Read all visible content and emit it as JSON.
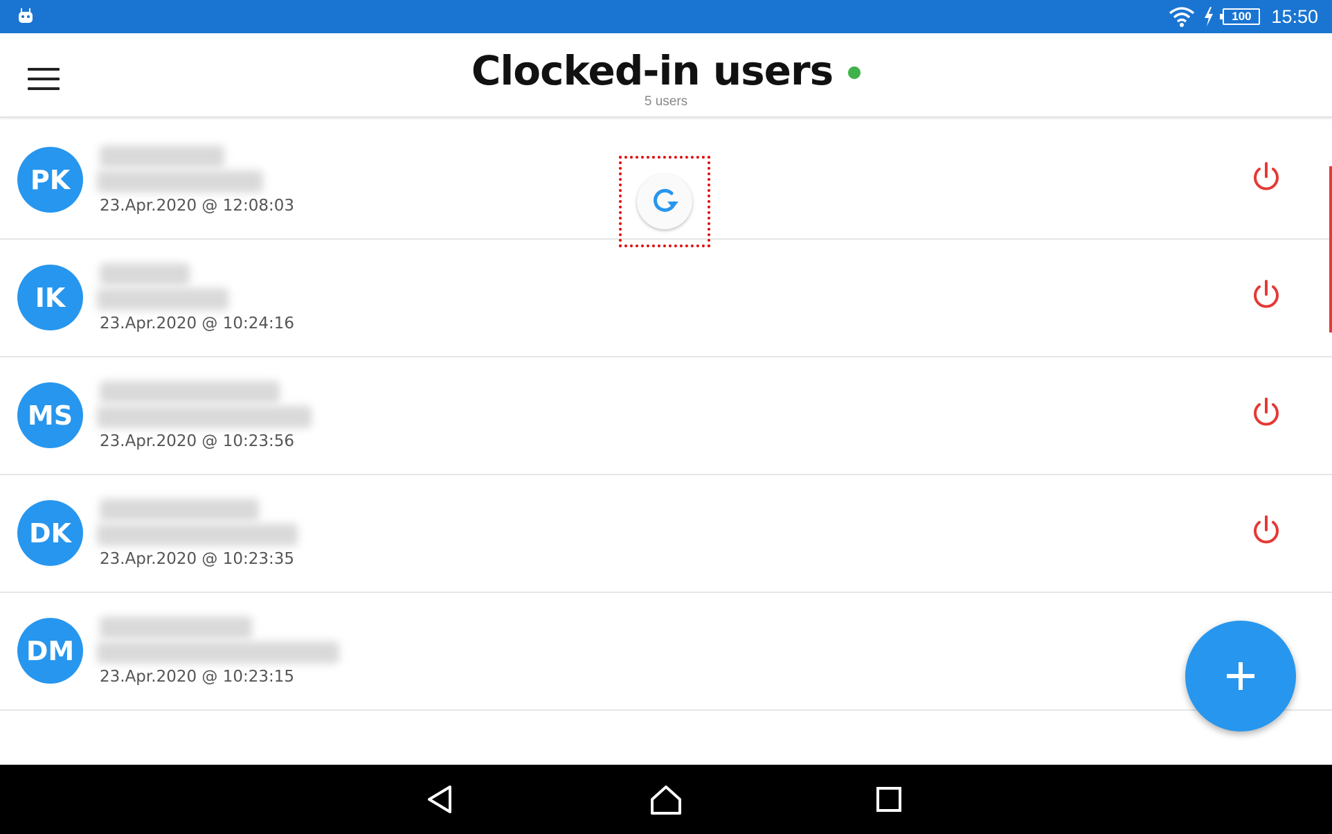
{
  "status_bar": {
    "battery_level": "100",
    "time": "15:50",
    "icons": [
      "android-debug-icon",
      "wifi-icon",
      "charging-icon",
      "battery-icon"
    ]
  },
  "app_bar": {
    "title": "Clocked-in users",
    "subtitle": "5 users",
    "online_color": "#3fb24a"
  },
  "users": [
    {
      "initials": "PK",
      "clock_in": "23.Apr.2020 @ 12:08:03"
    },
    {
      "initials": "IK",
      "clock_in": "23.Apr.2020 @ 10:24:16"
    },
    {
      "initials": "MS",
      "clock_in": "23.Apr.2020 @ 10:23:56"
    },
    {
      "initials": "DK",
      "clock_in": "23.Apr.2020 @ 10:23:35"
    },
    {
      "initials": "DM",
      "clock_in": "23.Apr.2020 @ 10:23:15"
    }
  ],
  "colors": {
    "accent": "#2796ee",
    "status_bar": "#1a75d2",
    "power": "#e53935",
    "highlight": "#e01010"
  }
}
